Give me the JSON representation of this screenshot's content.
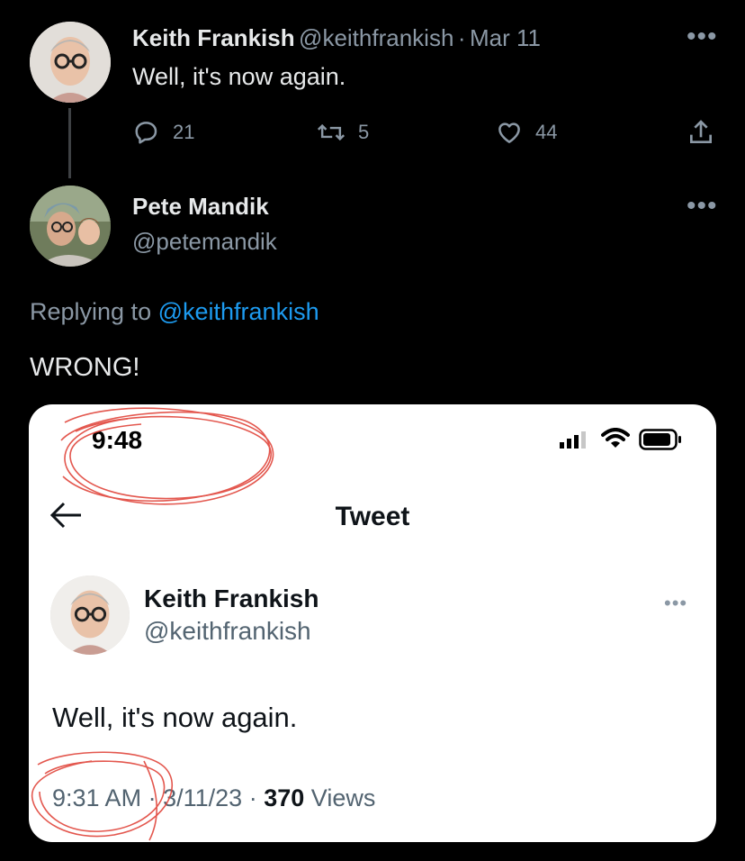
{
  "original_tweet": {
    "name": "Keith Frankish",
    "handle": "@keithfrankish",
    "separator": "·",
    "date": "Mar 11",
    "text": "Well, it's now again.",
    "replies": "21",
    "retweets": "5",
    "likes": "44"
  },
  "reply": {
    "name": "Pete Mandik",
    "handle": "@petemandik",
    "replying_prefix": "Replying to",
    "replying_handle": "@keithfrankish",
    "text": "WRONG!"
  },
  "screenshot": {
    "status_time": "9:48",
    "title": "Tweet",
    "name": "Keith Frankish",
    "handle": "@keithfrankish",
    "text": "Well, it's now again.",
    "time": "9:31 AM",
    "sep1": "·",
    "date": "3/11/23",
    "sep2": "·",
    "views_count": "370",
    "views_label": "Views"
  },
  "colors": {
    "background": "#000000",
    "link": "#1d9bf0",
    "muted": "#8b98a5",
    "scribble": "#e0453b"
  },
  "icons": [
    "reply-icon",
    "retweet-icon",
    "like-icon",
    "share-icon",
    "more-icon",
    "back-arrow-icon",
    "signal-icon",
    "wifi-icon",
    "battery-icon"
  ]
}
